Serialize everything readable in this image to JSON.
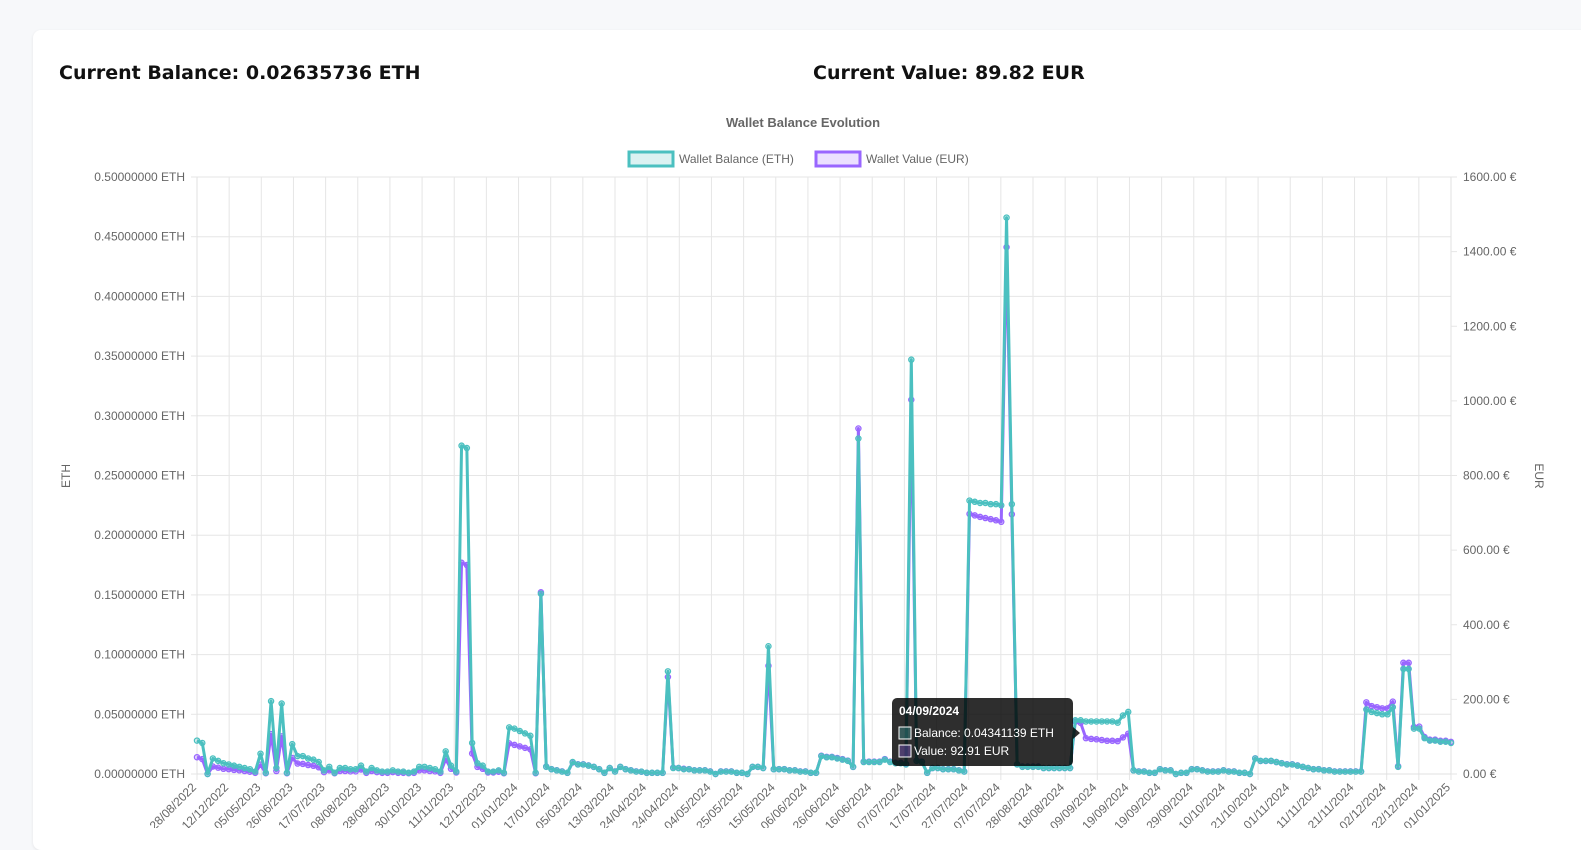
{
  "summary": {
    "balance_label": "Current Balance:",
    "balance_value": "0.02635736 ETH",
    "value_label": "Current Value:",
    "value_value": "89.82 EUR"
  },
  "chart_data": {
    "type": "line",
    "title": "Wallet Balance Evolution",
    "legend_position": "top-center",
    "grid": true,
    "y_left": {
      "label": "ETH",
      "min": 0,
      "max": 0.5,
      "step": 0.05,
      "ticks": [
        "0.00000000 ETH",
        "0.05000000 ETH",
        "0.10000000 ETH",
        "0.15000000 ETH",
        "0.20000000 ETH",
        "0.25000000 ETH",
        "0.30000000 ETH",
        "0.35000000 ETH",
        "0.40000000 ETH",
        "0.45000000 ETH",
        "0.50000000 ETH"
      ]
    },
    "y_right": {
      "label": "EUR",
      "min": 0,
      "max": 1600,
      "step": 200,
      "ticks": [
        "0.00 €",
        "200.00 €",
        "400.00 €",
        "600.00 €",
        "800.00 €",
        "1000.00 €",
        "1200.00 €",
        "1400.00 €",
        "1600.00 €"
      ]
    },
    "x_labels": [
      "28/08/2022",
      "12/12/2022",
      "05/05/2023",
      "26/06/2023",
      "17/07/2023",
      "08/08/2023",
      "28/08/2023",
      "30/10/2023",
      "11/11/2023",
      "12/12/2023",
      "01/01/2024",
      "17/01/2024",
      "05/03/2024",
      "13/03/2024",
      "24/04/2024",
      "24/04/2024",
      "04/05/2024",
      "25/05/2024",
      "15/05/2024",
      "06/06/2024",
      "26/06/2024",
      "16/06/2024",
      "07/07/2024",
      "17/07/2024",
      "27/07/2024",
      "07/07/2024",
      "28/08/2024",
      "18/08/2024",
      "09/09/2024",
      "19/09/2024",
      "19/09/2024",
      "29/09/2024",
      "10/10/2024",
      "21/10/2024",
      "01/11/2024",
      "11/11/2024",
      "21/11/2024",
      "02/12/2024",
      "22/12/2024",
      "01/01/2025"
    ],
    "series": [
      {
        "name": "Wallet Balance (ETH)",
        "axis": "left",
        "color": "#4bc0c0",
        "fill": "rgba(75,192,192,0.2)",
        "y": [
          0.028,
          0.026,
          0.0,
          0.013,
          0.011,
          0.009,
          0.008,
          0.007,
          0.006,
          0.005,
          0.004,
          0.002,
          0.017,
          0.001,
          0.061,
          0.005,
          0.059,
          0.001,
          0.025,
          0.015,
          0.015,
          0.013,
          0.012,
          0.01,
          0.003,
          0.006,
          0.001,
          0.005,
          0.005,
          0.004,
          0.004,
          0.007,
          0.002,
          0.005,
          0.003,
          0.002,
          0.002,
          0.003,
          0.002,
          0.002,
          0.001,
          0.002,
          0.006,
          0.006,
          0.005,
          0.004,
          0.002,
          0.019,
          0.007,
          0.002,
          0.275,
          0.273,
          0.026,
          0.009,
          0.007,
          0.002,
          0.002,
          0.003,
          0.001,
          0.039,
          0.038,
          0.036,
          0.034,
          0.032,
          0.001,
          0.151,
          0.006,
          0.004,
          0.003,
          0.002,
          0.001,
          0.01,
          0.008,
          0.008,
          0.007,
          0.006,
          0.004,
          0.001,
          0.005,
          0.002,
          0.006,
          0.004,
          0.003,
          0.002,
          0.002,
          0.001,
          0.001,
          0.001,
          0.001,
          0.086,
          0.005,
          0.005,
          0.004,
          0.004,
          0.003,
          0.003,
          0.003,
          0.002,
          0.0,
          0.002,
          0.002,
          0.002,
          0.001,
          0.001,
          0.0,
          0.006,
          0.006,
          0.005,
          0.107,
          0.004,
          0.004,
          0.004,
          0.003,
          0.003,
          0.002,
          0.002,
          0.001,
          0.001,
          0.015,
          0.014,
          0.014,
          0.013,
          0.012,
          0.011,
          0.006,
          0.281,
          0.01,
          0.01,
          0.01,
          0.01,
          0.012,
          0.01,
          0.009,
          0.009,
          0.008,
          0.347,
          0.011,
          0.01,
          0.001,
          0.005,
          0.005,
          0.004,
          0.004,
          0.004,
          0.003,
          0.002,
          0.229,
          0.228,
          0.227,
          0.227,
          0.226,
          0.226,
          0.225,
          0.466,
          0.226,
          0.008,
          0.006,
          0.006,
          0.006,
          0.006,
          0.005,
          0.005,
          0.005,
          0.005,
          0.005,
          0.005,
          0.045,
          0.045,
          0.044,
          0.044,
          0.044,
          0.044,
          0.044,
          0.044,
          0.043,
          0.049,
          0.052,
          0.003,
          0.002,
          0.002,
          0.001,
          0.001,
          0.004,
          0.003,
          0.003,
          0.0,
          0.001,
          0.001,
          0.004,
          0.004,
          0.003,
          0.002,
          0.002,
          0.002,
          0.003,
          0.002,
          0.002,
          0.001,
          0.001,
          0.0,
          0.013,
          0.011,
          0.011,
          0.011,
          0.01,
          0.009,
          0.008,
          0.008,
          0.007,
          0.006,
          0.005,
          0.004,
          0.004,
          0.003,
          0.003,
          0.002,
          0.002,
          0.002,
          0.002,
          0.002,
          0.002,
          0.054,
          0.052,
          0.051,
          0.05,
          0.05,
          0.056,
          0.006,
          0.088,
          0.088,
          0.038,
          0.038,
          0.03,
          0.028,
          0.028,
          0.027,
          0.027,
          0.026
        ]
      },
      {
        "name": "Wallet Value (EUR)",
        "axis": "right",
        "color": "#9966ff",
        "fill": "rgba(153,102,255,0.2)",
        "y": [
          45,
          40,
          0,
          20,
          17,
          14,
          13,
          11,
          10,
          8,
          6,
          3,
          25,
          2,
          107,
          8,
          101,
          2,
          43,
          28,
          27,
          24,
          22,
          18,
          5,
          10,
          2,
          8,
          8,
          7,
          7,
          12,
          3,
          8,
          5,
          3,
          3,
          5,
          3,
          3,
          2,
          3,
          10,
          10,
          8,
          7,
          3,
          40,
          14,
          4,
          566,
          560,
          55,
          19,
          14,
          4,
          4,
          6,
          2,
          82,
          78,
          74,
          70,
          66,
          2,
          487,
          20,
          13,
          10,
          7,
          3,
          31,
          26,
          26,
          23,
          19,
          13,
          3,
          16,
          7,
          19,
          13,
          10,
          7,
          6,
          3,
          3,
          3,
          3,
          260,
          17,
          16,
          14,
          13,
          10,
          10,
          10,
          7,
          0,
          7,
          7,
          7,
          3,
          3,
          0,
          19,
          19,
          16,
          290,
          13,
          13,
          13,
          10,
          10,
          7,
          7,
          3,
          3,
          49,
          46,
          46,
          43,
          40,
          36,
          19,
          926,
          33,
          33,
          33,
          33,
          40,
          33,
          30,
          30,
          27,
          1003,
          36,
          33,
          3,
          16,
          16,
          13,
          13,
          13,
          10,
          7,
          697,
          693,
          689,
          686,
          683,
          680,
          676,
          1412,
          696,
          26,
          20,
          20,
          20,
          20,
          16,
          16,
          16,
          16,
          16,
          16,
          140,
          137,
          96,
          94,
          93,
          91,
          89,
          89,
          88,
          98,
          108,
          10,
          7,
          7,
          3,
          3,
          13,
          10,
          10,
          0,
          3,
          3,
          13,
          13,
          10,
          7,
          7,
          7,
          10,
          7,
          7,
          3,
          3,
          0,
          42,
          35,
          35,
          35,
          32,
          29,
          26,
          26,
          23,
          19,
          16,
          13,
          13,
          10,
          10,
          7,
          7,
          7,
          7,
          7,
          7,
          192,
          182,
          179,
          176,
          176,
          194,
          21,
          298,
          298,
          126,
          127,
          99,
          92,
          92,
          89,
          89,
          86
        ]
      }
    ]
  },
  "tooltip": {
    "title": "04/09/2024",
    "balance_line": "Balance: 0.04341139 ETH",
    "value_line": "Value: 92.91 EUR"
  }
}
